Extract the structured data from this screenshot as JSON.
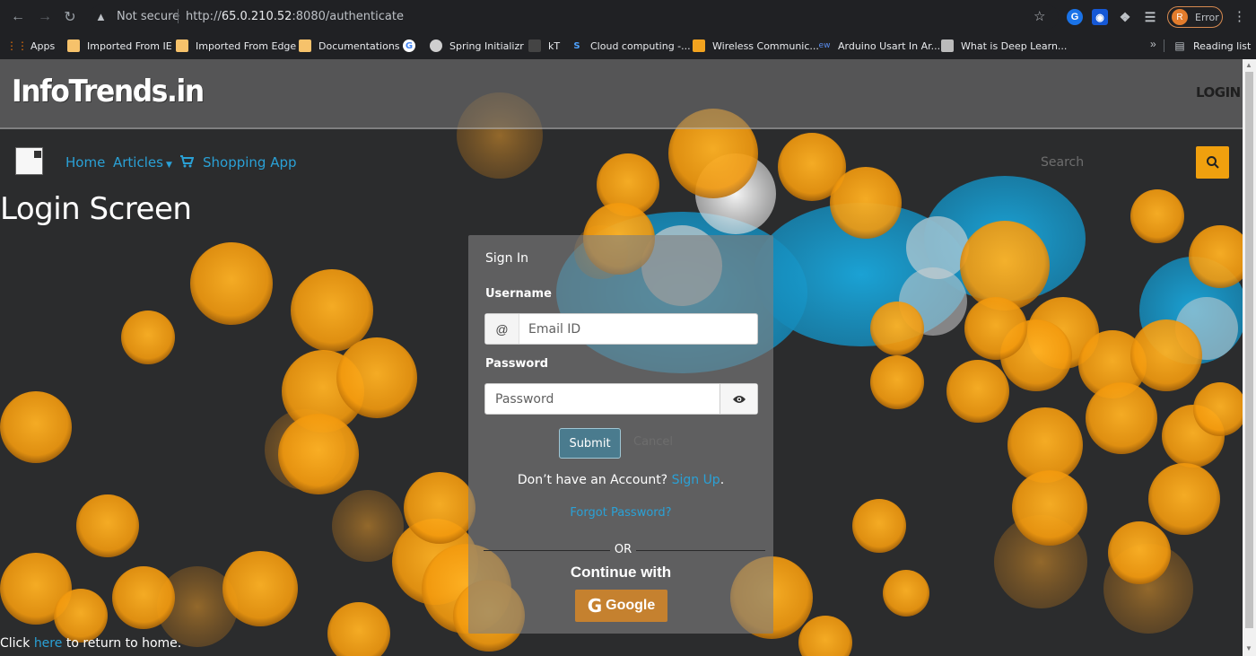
{
  "browser": {
    "security_label": "Not secure",
    "url_prefix": "http://",
    "url_host": "65.0.210.52",
    "url_rest": ":8080/authenticate",
    "profile_initial": "R",
    "profile_label": "Error",
    "bookmarks": [
      {
        "label": "Apps",
        "icon": "apps-grid-icon",
        "color": "#e8710a"
      },
      {
        "label": "Imported From IE",
        "icon": "folder-icon",
        "color": "#f6c26b"
      },
      {
        "label": "Imported From Edge",
        "icon": "folder-icon",
        "color": "#f6c26b"
      },
      {
        "label": "Documentations",
        "icon": "folder-icon",
        "color": "#f6c26b"
      },
      {
        "label": "",
        "icon": "google-icon",
        "color": "#ffffff"
      },
      {
        "label": "Spring Initializr",
        "icon": "spring-icon",
        "color": "#cfcfcf"
      },
      {
        "label": "kT",
        "icon": "kt-icon",
        "color": "#444444"
      },
      {
        "label": "Cloud computing -...",
        "icon": "s-icon",
        "color": "#4ea3ff"
      },
      {
        "label": "Wireless Communic...",
        "icon": "book-icon",
        "color": "#f2a31f"
      },
      {
        "label": "Arduino Usart In Ar...",
        "icon": "ew-icon",
        "color": "#5a8dee"
      },
      {
        "label": "What is Deep Learn...",
        "icon": "image-icon",
        "color": "#bbbbbb"
      }
    ],
    "reading_list_label": "Reading list"
  },
  "site": {
    "brand": "InfoTrends.in",
    "header_login": "LOGIN",
    "nav": {
      "home": "Home",
      "articles": "Articles",
      "shopping": "Shopping App",
      "search_placeholder": "Search"
    },
    "page_title": "Login Screen"
  },
  "login": {
    "title": "Sign In",
    "username_label": "Username",
    "username_addon": "@",
    "username_placeholder": "Email ID",
    "password_label": "Password",
    "password_placeholder": "Password",
    "submit": "Submit",
    "cancel": "Cancel",
    "no_account_text": "Don’t have an Account?",
    "signup_link": "Sign Up",
    "signup_trailing": ".",
    "forgot_password": "Forgot Password?",
    "or": "OR",
    "continue_with": "Continue with",
    "google_label": "Google"
  },
  "footer": {
    "prefix": "Click",
    "link": "here",
    "suffix": "to return to home."
  },
  "colors": {
    "accent_blue": "#2aa1d6",
    "accent_orange": "#f0a00e",
    "google_button": "#c5812f",
    "submit_button": "#4a7b8e"
  }
}
